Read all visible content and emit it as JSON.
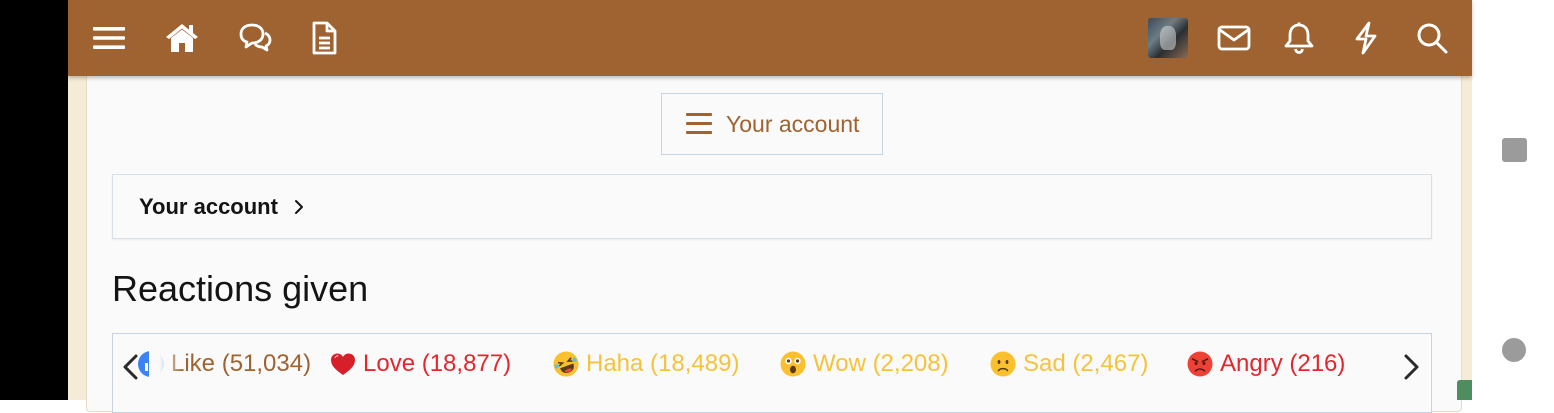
{
  "nav": {
    "icons": [
      "menu-icon",
      "home-icon",
      "forums-icon",
      "document-icon",
      "mail-icon",
      "bell-icon",
      "bolt-icon",
      "search-icon"
    ]
  },
  "account_button": {
    "label": "Your account"
  },
  "breadcrumb": {
    "label": "Your account"
  },
  "page_title": "Reactions given",
  "reactions": [
    {
      "name": "Like",
      "label": "Like (51,034)",
      "color": "#9e6330",
      "icon": "like-icon"
    },
    {
      "name": "Love",
      "label": "Love (18,877)",
      "color": "#e5262d",
      "icon": "heart-icon"
    },
    {
      "name": "Haha",
      "label": "Haha (18,489)",
      "color": "#f5c33b",
      "icon": "laughing-emoji-icon"
    },
    {
      "name": "Wow",
      "label": "Wow (2,208)",
      "color": "#f5c33b",
      "icon": "astonished-emoji-icon"
    },
    {
      "name": "Sad",
      "label": "Sad (2,467)",
      "color": "#f5c33b",
      "icon": "sad-emoji-icon"
    },
    {
      "name": "Angry",
      "label": "Angry (216)",
      "color": "#e5262d",
      "icon": "angry-emoji-icon"
    }
  ],
  "colors": {
    "header_bg": "#9e6330",
    "accent": "#9e6330",
    "page_bg": "#f4ecd6",
    "scroll_top": "#4f8d5e"
  }
}
